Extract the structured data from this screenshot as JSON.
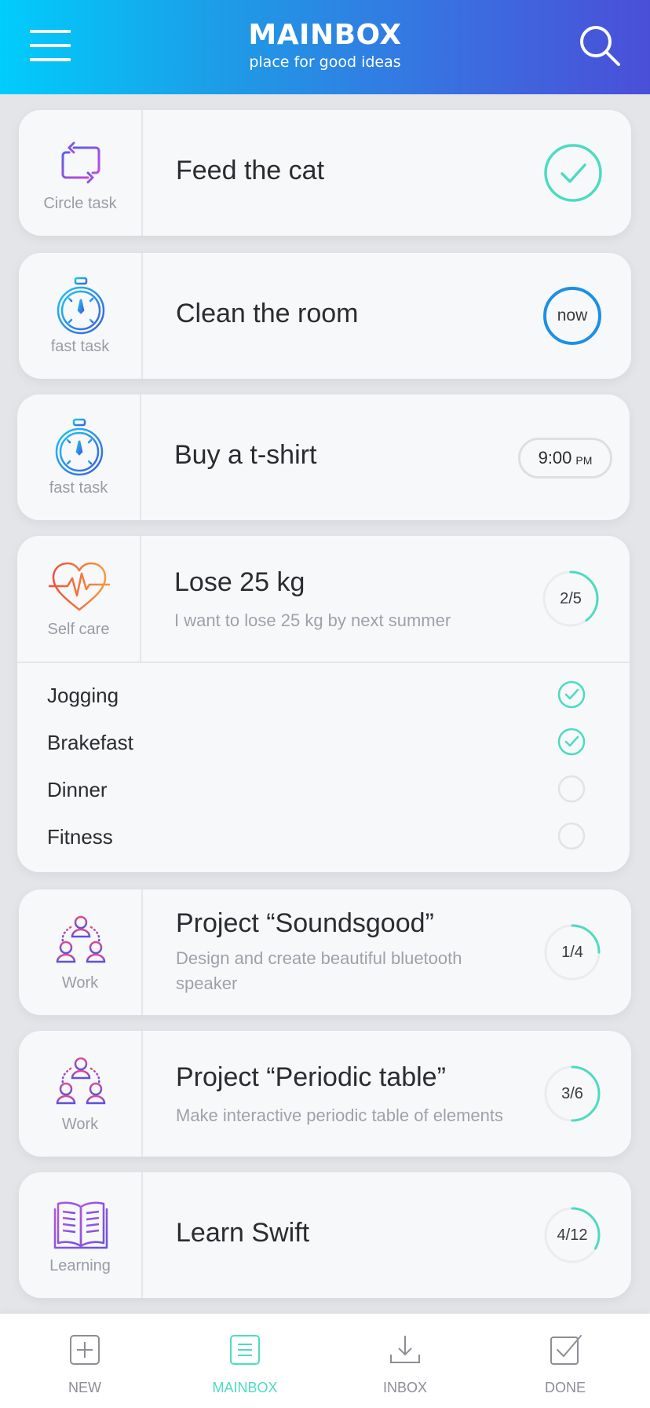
{
  "header": {
    "title": "MAINBOX",
    "subtitle": "place for good ideas"
  },
  "colors": {
    "accent_teal": "#4ddbc1",
    "accent_blue": "#1c8fe6",
    "header_gradient_start": "#00cdfb",
    "header_gradient_end": "#4a4fd8"
  },
  "tasks": [
    {
      "category": "Circle task",
      "category_icon": "repeat-icon",
      "title": "Feed the cat",
      "status": "done"
    },
    {
      "category": "fast task",
      "category_icon": "stopwatch-icon",
      "title": "Clean the room",
      "status_label": "now"
    },
    {
      "category": "fast task",
      "category_icon": "stopwatch-icon",
      "title": "Buy a t-shirt",
      "time": "9:00",
      "ampm": "PM"
    },
    {
      "category": "Self care",
      "category_icon": "heart-pulse-icon",
      "title": "Lose 25 kg",
      "description": "I want to lose 25 kg by next summer",
      "progress_label": "2/5",
      "progress": 0.4,
      "subtasks": [
        {
          "label": "Jogging",
          "done": true
        },
        {
          "label": "Brakefast",
          "done": true
        },
        {
          "label": "Dinner",
          "done": false
        },
        {
          "label": "Fitness",
          "done": false
        }
      ]
    },
    {
      "category": "Work",
      "category_icon": "team-icon",
      "title": "Project “Soundsgood”",
      "description": "Design and create beautiful bluetooth speaker",
      "progress_label": "1/4",
      "progress": 0.25
    },
    {
      "category": "Work",
      "category_icon": "team-icon",
      "title": "Project “Periodic table”",
      "description": "Make interactive periodic table of elements",
      "progress_label": "3/6",
      "progress": 0.5
    },
    {
      "category": "Learning",
      "category_icon": "book-icon",
      "title": "Learn Swift",
      "progress_label": "4/12",
      "progress": 0.333
    }
  ],
  "nav": [
    {
      "label": "NEW",
      "icon": "plus-square-icon",
      "active": false
    },
    {
      "label": "MAINBOX",
      "icon": "list-icon",
      "active": true
    },
    {
      "label": "INBOX",
      "icon": "download-icon",
      "active": false
    },
    {
      "label": "DONE",
      "icon": "checkbox-icon",
      "active": false
    }
  ]
}
